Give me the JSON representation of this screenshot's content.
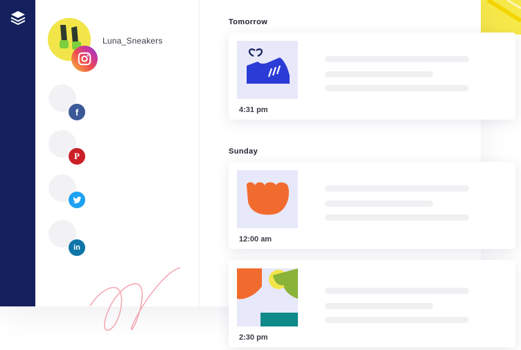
{
  "account": {
    "name": "Luna_Sneakers",
    "network": "instagram-icon"
  },
  "other_networks": [
    "facebook-icon",
    "pinterest-icon",
    "twitter-icon",
    "linkedin-icon"
  ],
  "schedule": [
    {
      "day": "Tomorrow",
      "posts": [
        {
          "time": "4:31 pm",
          "image": "sneaker-illustration"
        }
      ]
    },
    {
      "day": "Sunday",
      "posts": [
        {
          "time": "12:00 am",
          "image": "orange-blob-illustration"
        },
        {
          "time": "2:30 pm",
          "image": "abstract-shapes-illustration"
        }
      ]
    }
  ],
  "colors": {
    "rail": "#15215e",
    "facebook": "#3b5998",
    "pinterest": "#cb2027",
    "twitter": "#1da1f2",
    "linkedin": "#0e76a8",
    "thumb_bg": "#e8e8fb",
    "accent_yellow": "#f7e84a"
  }
}
